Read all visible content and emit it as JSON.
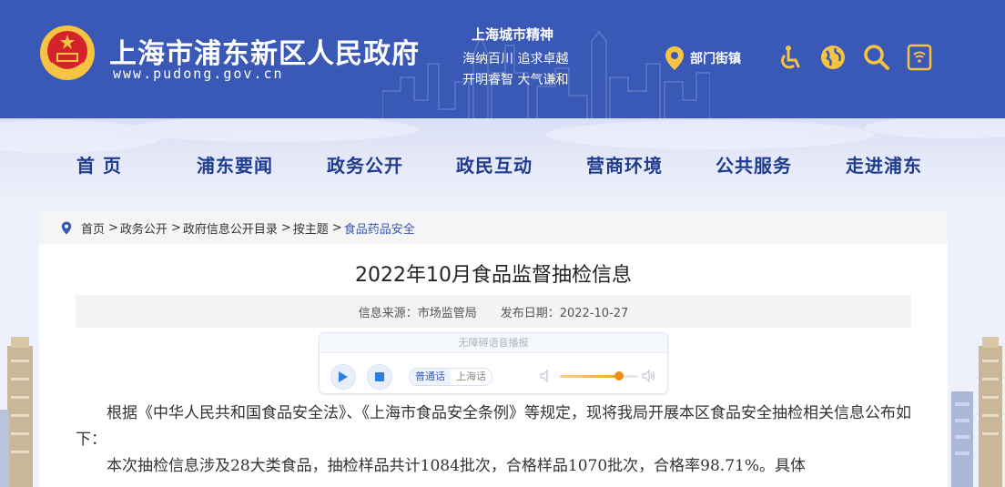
{
  "header": {
    "site_title": "上海市浦东新区人民政府",
    "site_url": "www.pudong.gov.cn",
    "spirit_title": "上海城市精神",
    "spirit_line1": "海纳百川  追求卓越",
    "spirit_line2": "开明睿智  大气谦和",
    "dept_label": "部门街镇",
    "icons": [
      "accessibility-icon",
      "globe-icon",
      "search-icon",
      "mobile-icon"
    ],
    "bg_color": "#3a58b5"
  },
  "nav": {
    "items": [
      "首  页",
      "浦东要闻",
      "政务公开",
      "政民互动",
      "营商环境",
      "公共服务",
      "走进浦东"
    ],
    "text_color": "#1f3c8f"
  },
  "breadcrumb": {
    "items": [
      "首页",
      "政务公开",
      "政府信息公开目录",
      "按主题",
      "食品药品安全"
    ],
    "separator": ">"
  },
  "article": {
    "title": "2022年10月食品监督抽检信息",
    "source_label": "信息来源：市场监管局",
    "date_label": "发布日期：2022-10-27"
  },
  "player": {
    "title": "无障碍语音播报",
    "lang_options": [
      "普通话",
      "上海话"
    ],
    "selected_lang": "普通话",
    "volume": 0.75,
    "accent": "#f5a623"
  },
  "body": {
    "paragraphs": [
      "根据《中华人民共和国食品安全法》、《上海市食品安全条例》等规定，现将我局开展本区食品安全抽检相关信息公布如下：",
      "本次抽检信息涉及28大类食品，抽检样品共计1084批次，合格样品1070批次，合格率98.71%。具体"
    ]
  }
}
